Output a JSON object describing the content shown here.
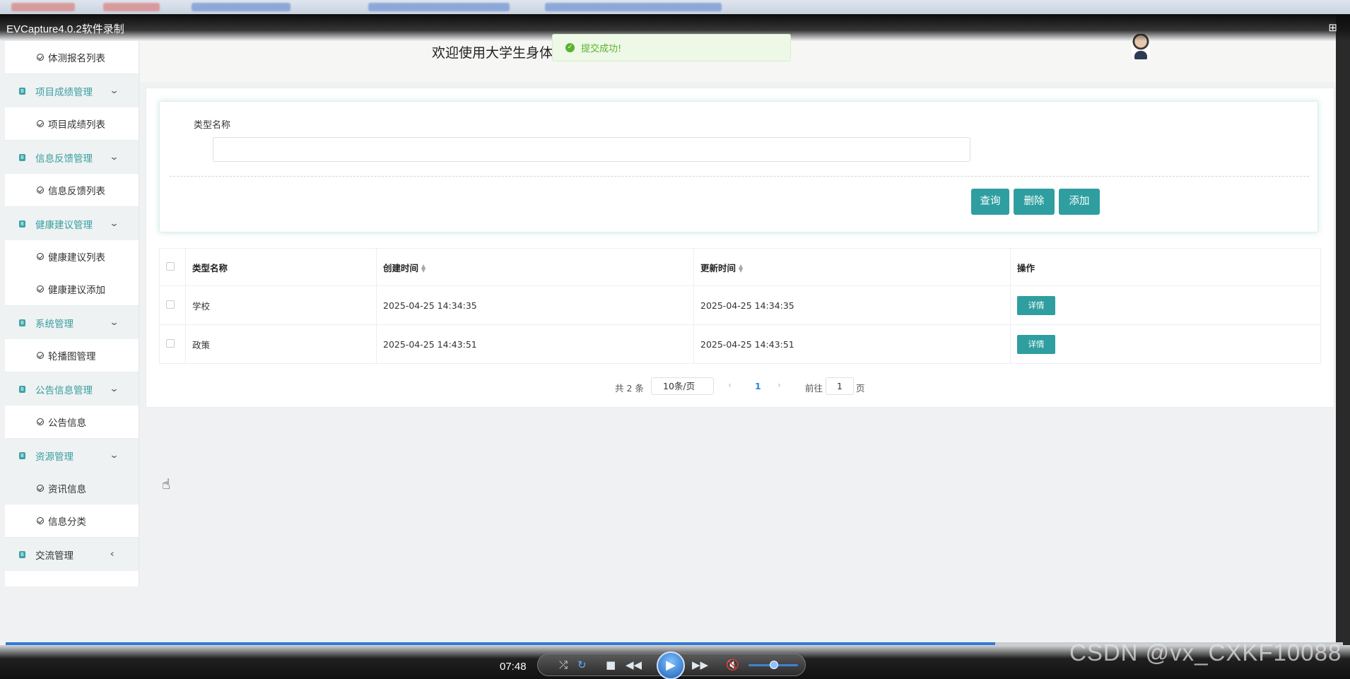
{
  "recorder": {
    "title": "EVCapture4.0.2软件录制",
    "time": "07:48",
    "watermark": "CSDN @vx_CXKF10088"
  },
  "header": {
    "welcome": "欢迎使用大学生身体"
  },
  "toast": {
    "text": "提交成功!"
  },
  "sidebar": {
    "items": [
      {
        "type": "item",
        "label": "体测报名列表"
      },
      {
        "type": "group",
        "label": "项目成绩管理"
      },
      {
        "type": "item",
        "label": "项目成绩列表"
      },
      {
        "type": "group",
        "label": "信息反馈管理"
      },
      {
        "type": "item",
        "label": "信息反馈列表"
      },
      {
        "type": "group",
        "label": "健康建议管理"
      },
      {
        "type": "item",
        "label": "健康建议列表"
      },
      {
        "type": "item",
        "label": "健康建议添加"
      },
      {
        "type": "group",
        "label": "系统管理"
      },
      {
        "type": "item",
        "label": "轮播图管理"
      },
      {
        "type": "group",
        "label": "公告信息管理"
      },
      {
        "type": "item",
        "label": "公告信息"
      },
      {
        "type": "group",
        "label": "资源管理"
      },
      {
        "type": "item",
        "label": "资讯信息"
      },
      {
        "type": "item",
        "label": "信息分类"
      },
      {
        "type": "group",
        "label": "交流管理"
      }
    ]
  },
  "search": {
    "label": "类型名称",
    "value": "",
    "buttons": {
      "query": "查询",
      "delete": "删除",
      "add": "添加"
    }
  },
  "table": {
    "headers": [
      "类型名称",
      "创建时间",
      "更新时间",
      "操作"
    ],
    "rows": [
      {
        "name": "学校",
        "created": "2025-04-25 14:34:35",
        "updated": "2025-04-25 14:34:35",
        "action": "详情"
      },
      {
        "name": "政策",
        "created": "2025-04-25 14:43:51",
        "updated": "2025-04-25 14:43:51",
        "action": "详情"
      }
    ]
  },
  "pagination": {
    "total": "共 2 条",
    "page_size": "10条/页",
    "current_page": "1",
    "goto_label": "前往",
    "goto_value": "1",
    "page_suffix": "页"
  },
  "colors": {
    "accent": "#2f9ea0",
    "success": "#5cb130"
  }
}
